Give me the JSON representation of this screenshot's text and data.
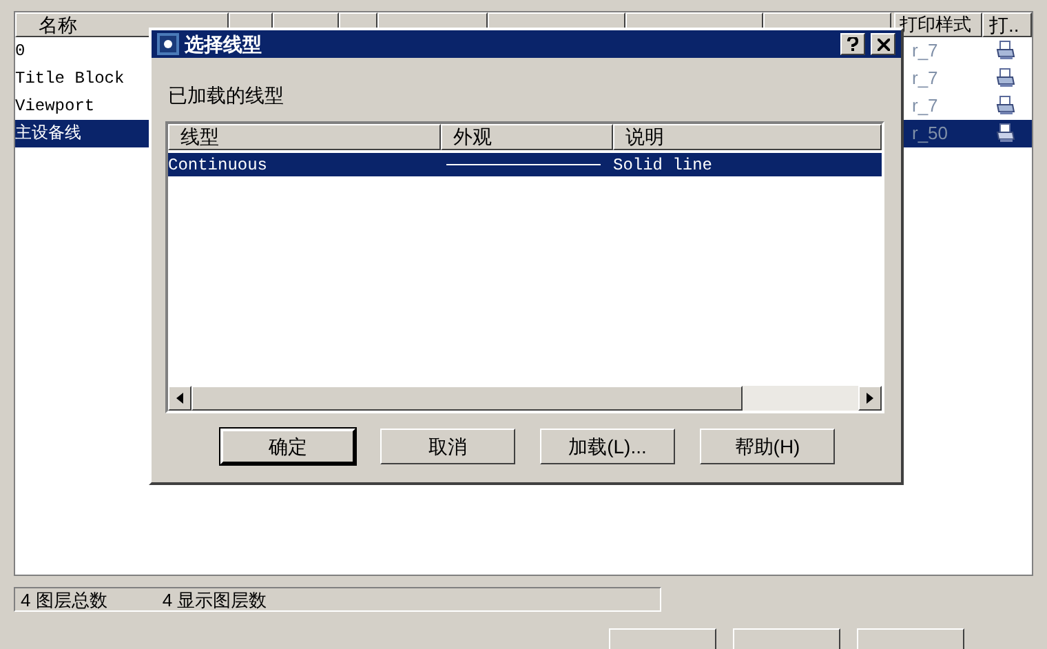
{
  "layer_list": {
    "columns": [
      {
        "label": "名称"
      },
      {
        "label": "打印样式"
      },
      {
        "label": "打.."
      }
    ],
    "rows": [
      {
        "name": "0",
        "print_style": "r_7",
        "selected": false
      },
      {
        "name": "Title Block",
        "print_style": "r_7",
        "selected": false
      },
      {
        "name": "Viewport",
        "print_style": "r_7",
        "selected": false
      },
      {
        "name": "主设备线",
        "print_style": "r_50",
        "selected": true
      }
    ]
  },
  "status_bar": [
    "4 图层总数",
    "4 显示图层数"
  ],
  "dialog": {
    "title": "选择线型",
    "section_label": "已加载的线型",
    "columns": [
      "线型",
      "外观",
      "说明"
    ],
    "rows": [
      {
        "name": "Continuous",
        "description": "Solid line",
        "selected": true
      }
    ],
    "buttons": [
      {
        "label": "确定",
        "default": true
      },
      {
        "label": "取消",
        "default": false
      },
      {
        "label": "加载(L)...",
        "default": false
      },
      {
        "label": "帮助(H)",
        "default": false
      }
    ]
  }
}
